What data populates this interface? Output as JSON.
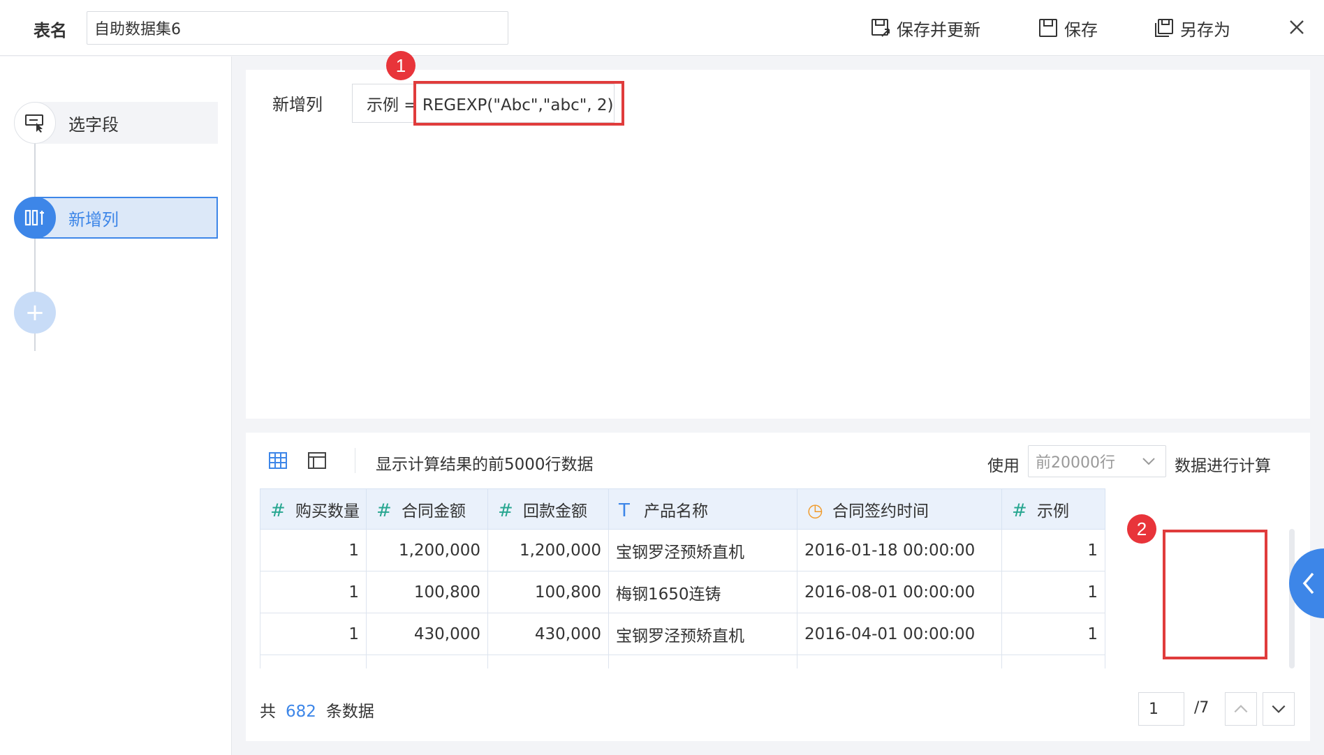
{
  "header": {
    "table_name_label": "表名",
    "table_name_value": "自助数据集6",
    "save_update_label": "保存并更新",
    "save_label": "保存",
    "save_as_label": "另存为"
  },
  "steps": {
    "select_fields": "选字段",
    "add_column": "新增列",
    "add_icon": "+"
  },
  "formula": {
    "label": "新增列",
    "expression": "示例 = REGEXP(\"Abc\",\"abc\", 2)"
  },
  "annotations": {
    "badge1": "1",
    "badge2": "2"
  },
  "preview": {
    "info": "显示计算结果的前5000行数据",
    "use_label": "使用",
    "row_limit_value": "前20000行",
    "calc_label": "数据进行计算"
  },
  "table": {
    "columns": [
      {
        "type_icon": "#",
        "type": "number",
        "label": "购买数量"
      },
      {
        "type_icon": "#",
        "type": "number",
        "label": "合同金额"
      },
      {
        "type_icon": "#",
        "type": "number",
        "label": "回款金额"
      },
      {
        "type_icon": "T",
        "type": "text",
        "label": "产品名称"
      },
      {
        "type_icon": "◷",
        "type": "time",
        "label": "合同签约时间"
      },
      {
        "type_icon": "#",
        "type": "number",
        "label": "示例"
      }
    ],
    "rows": [
      [
        "1",
        "1,200,000",
        "1,200,000",
        "宝钢罗泾预矫直机",
        "2016-01-18 00:00:00",
        "1"
      ],
      [
        "1",
        "100,800",
        "100,800",
        "梅钢1650连铸",
        "2016-08-01 00:00:00",
        "1"
      ],
      [
        "1",
        "430,000",
        "430,000",
        "宝钢罗泾预矫直机",
        "2016-04-01 00:00:00",
        "1"
      ]
    ]
  },
  "footer": {
    "total_prefix": "共",
    "total_count": "682",
    "total_suffix": "条数据",
    "page_value": "1",
    "page_total": "/7"
  },
  "colors": {
    "accent": "#3d86e8",
    "highlight": "#e03c3c",
    "number_icon": "#27a690",
    "time_icon": "#f09a2a"
  }
}
